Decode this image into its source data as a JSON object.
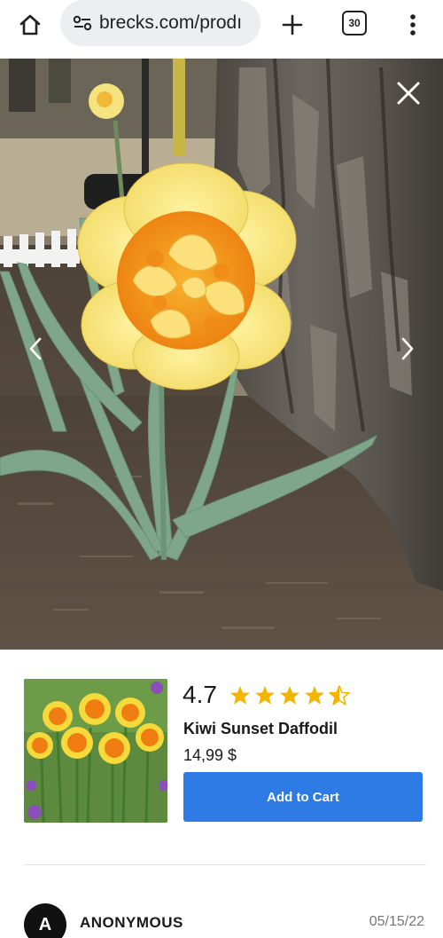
{
  "browser": {
    "url": "brecks.com/prodı",
    "tab_count": "30",
    "icons": {
      "home": "home-icon",
      "site_info": "site-settings-icon",
      "new_tab": "plus-icon",
      "menu": "kebab-menu-icon"
    }
  },
  "gallery": {
    "close_icon": "close-icon",
    "prev_icon": "chevron-left-icon",
    "next_icon": "chevron-right-icon"
  },
  "product": {
    "rating": "4.7",
    "rating_stars": 4.5,
    "name": "Kiwi Sunset Daffodil",
    "price": "14,99 $",
    "add_to_cart_label": "Add to Cart",
    "star_color": "#f5b400",
    "button_color": "#2f7be6"
  },
  "review": {
    "avatar_letter": "A",
    "reviewer": "ANONYMOUS",
    "date": "05/15/22"
  }
}
